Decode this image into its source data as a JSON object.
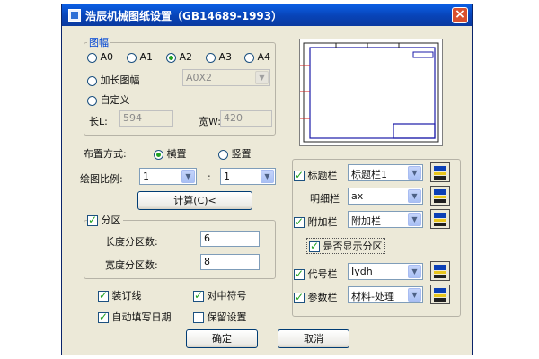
{
  "window": {
    "title": "浩辰机械图纸设置（GB14689-1993）"
  },
  "paper_size": {
    "legend": "图幅",
    "options": [
      "A0",
      "A1",
      "A2",
      "A3",
      "A4"
    ],
    "selected": "A2",
    "extended_label": "加长图幅",
    "extended_value": "A0X2",
    "custom_label": "自定义",
    "length_label": "长L:",
    "length_value": "594",
    "width_label": "宽W:",
    "width_value": "420"
  },
  "orientation": {
    "label": "布置方式:",
    "landscape": "横置",
    "portrait": "竖置"
  },
  "scale": {
    "label": "绘图比例:",
    "left_value": "1",
    "colon": ":",
    "right_value": "1",
    "calc_button": "计算(C)<"
  },
  "zones": {
    "label": "分区",
    "length_label": "长度分区数:",
    "length_value": "6",
    "width_label": "宽度分区数:",
    "width_value": "8"
  },
  "options": {
    "binding": "装订线",
    "center_mark": "对中符号",
    "auto_date": "自动填写日期",
    "keep_settings": "保留设置"
  },
  "right_panel": {
    "title_block_label": "标题栏",
    "title_block_value": "标题栏1",
    "detail_label": "明细栏",
    "detail_value": "ax",
    "extra_label": "附加栏",
    "extra_value": "附加栏",
    "show_zones_label": "是否显示分区",
    "code_label": "代号栏",
    "code_value": "Iydh",
    "param_label": "参数栏",
    "param_value": "材料-处理"
  },
  "buttons": {
    "ok": "确定",
    "cancel": "取消"
  }
}
